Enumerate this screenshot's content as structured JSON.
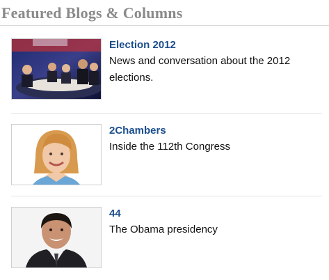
{
  "header": {
    "title": "Featured Blogs & Columns"
  },
  "items": [
    {
      "title": "Election 2012",
      "description": "News and conversation about the 2012 elections.",
      "thumbnail_icon": "debate-stage-photo"
    },
    {
      "title": "2Chambers",
      "description": "Inside the 112th Congress",
      "thumbnail_icon": "columnist-portrait-photo"
    },
    {
      "title": "44",
      "description": "The Obama presidency",
      "thumbnail_icon": "columnist-portrait-photo"
    }
  ],
  "colors": {
    "header_text": "#8a8a8a",
    "link": "#1b4e8c",
    "divider": "#e3e3e3"
  }
}
